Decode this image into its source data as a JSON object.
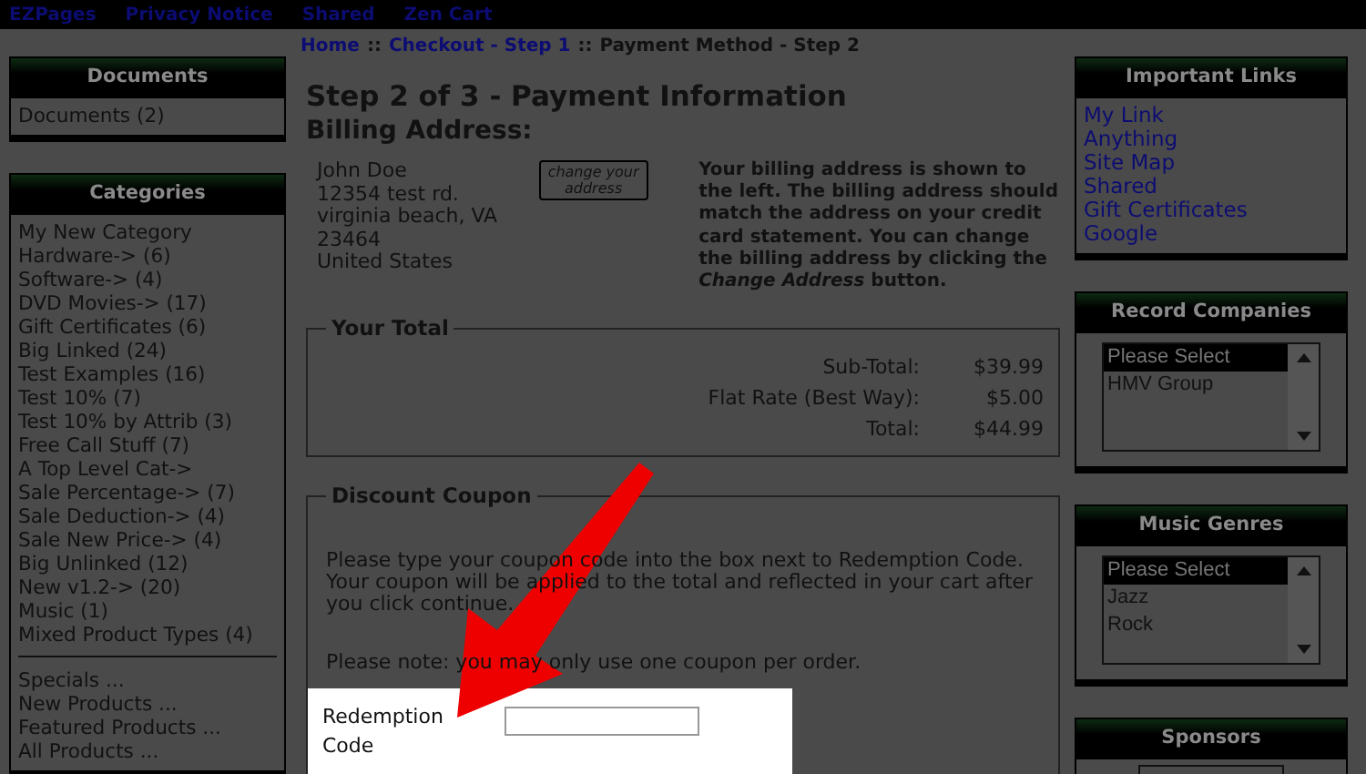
{
  "top_nav": [
    "EZPages",
    "Privacy Notice",
    "Shared",
    "Zen Cart"
  ],
  "left_boxes": [
    {
      "title": "Documents",
      "items": [
        "Documents (2)"
      ]
    },
    {
      "title": "Categories",
      "items": [
        "My New Category",
        "Hardware-> (6)",
        "Software-> (4)",
        "DVD Movies-> (17)",
        "Gift Certificates (6)",
        "Big Linked (24)",
        "Test Examples (16)",
        "Test 10% (7)",
        "Test 10% by Attrib (3)",
        "Free Call Stuff (7)",
        "A Top Level Cat->",
        "Sale Percentage-> (7)",
        "Sale Deduction-> (4)",
        "Sale New Price-> (4)",
        "Big Unlinked (12)",
        "New v1.2-> (20)",
        "Music (1)",
        "Mixed Product Types (4)"
      ],
      "extra_items": [
        "Specials ...",
        "New Products ...",
        "Featured Products ...",
        "All Products ..."
      ]
    }
  ],
  "breadcrumb": [
    {
      "kind": "link",
      "text": "Home"
    },
    {
      "kind": "sep",
      "text": "::"
    },
    {
      "kind": "link",
      "text": "Checkout - Step 1"
    },
    {
      "kind": "sep",
      "text": "::"
    },
    {
      "kind": "current",
      "text": "Payment Method - Step 2"
    }
  ],
  "page_title": "Step 2 of 3 - Payment Information",
  "billing": {
    "heading": "Billing Address:",
    "address": [
      "John Doe",
      "12354 test rd.",
      "virginia beach, VA",
      "23464",
      "United States"
    ],
    "change_button": "change your address",
    "note": "Your billing address is shown to the left. The billing address should match the address on your credit card statement. You can change the billing address by clicking the *Change Address* button."
  },
  "your_total": {
    "legend": "Your Total",
    "rows": [
      {
        "label": "Sub-Total:",
        "value": "$39.99"
      },
      {
        "label": "Flat Rate (Best Way):",
        "value": "$5.00"
      },
      {
        "label": "Total:",
        "value": "$44.99"
      }
    ]
  },
  "coupon": {
    "legend": "Discount Coupon",
    "instructions": "Please type your coupon code into the box next to Redemption Code. Your coupon will be applied to the total and reflected in your cart after you click continue.",
    "note": "Please note: you may only use one coupon per order.",
    "field_label": "Redemption Code"
  },
  "right_boxes": [
    {
      "kind": "links",
      "title": "Important Links",
      "items": [
        "My Link",
        "Anything",
        "Site Map",
        "Shared",
        "Gift Certificates",
        "Google"
      ]
    },
    {
      "kind": "select",
      "title": "Record Companies",
      "options": [
        {
          "text": "Please Select",
          "selected": true
        },
        {
          "text": "HMV Group",
          "selected": false
        }
      ]
    },
    {
      "kind": "select",
      "title": "Music Genres",
      "options": [
        {
          "text": "Please Select",
          "selected": true
        },
        {
          "text": "Jazz",
          "selected": false
        },
        {
          "text": "Rock",
          "selected": false
        }
      ]
    },
    {
      "kind": "logo",
      "title": "Sponsors"
    }
  ]
}
